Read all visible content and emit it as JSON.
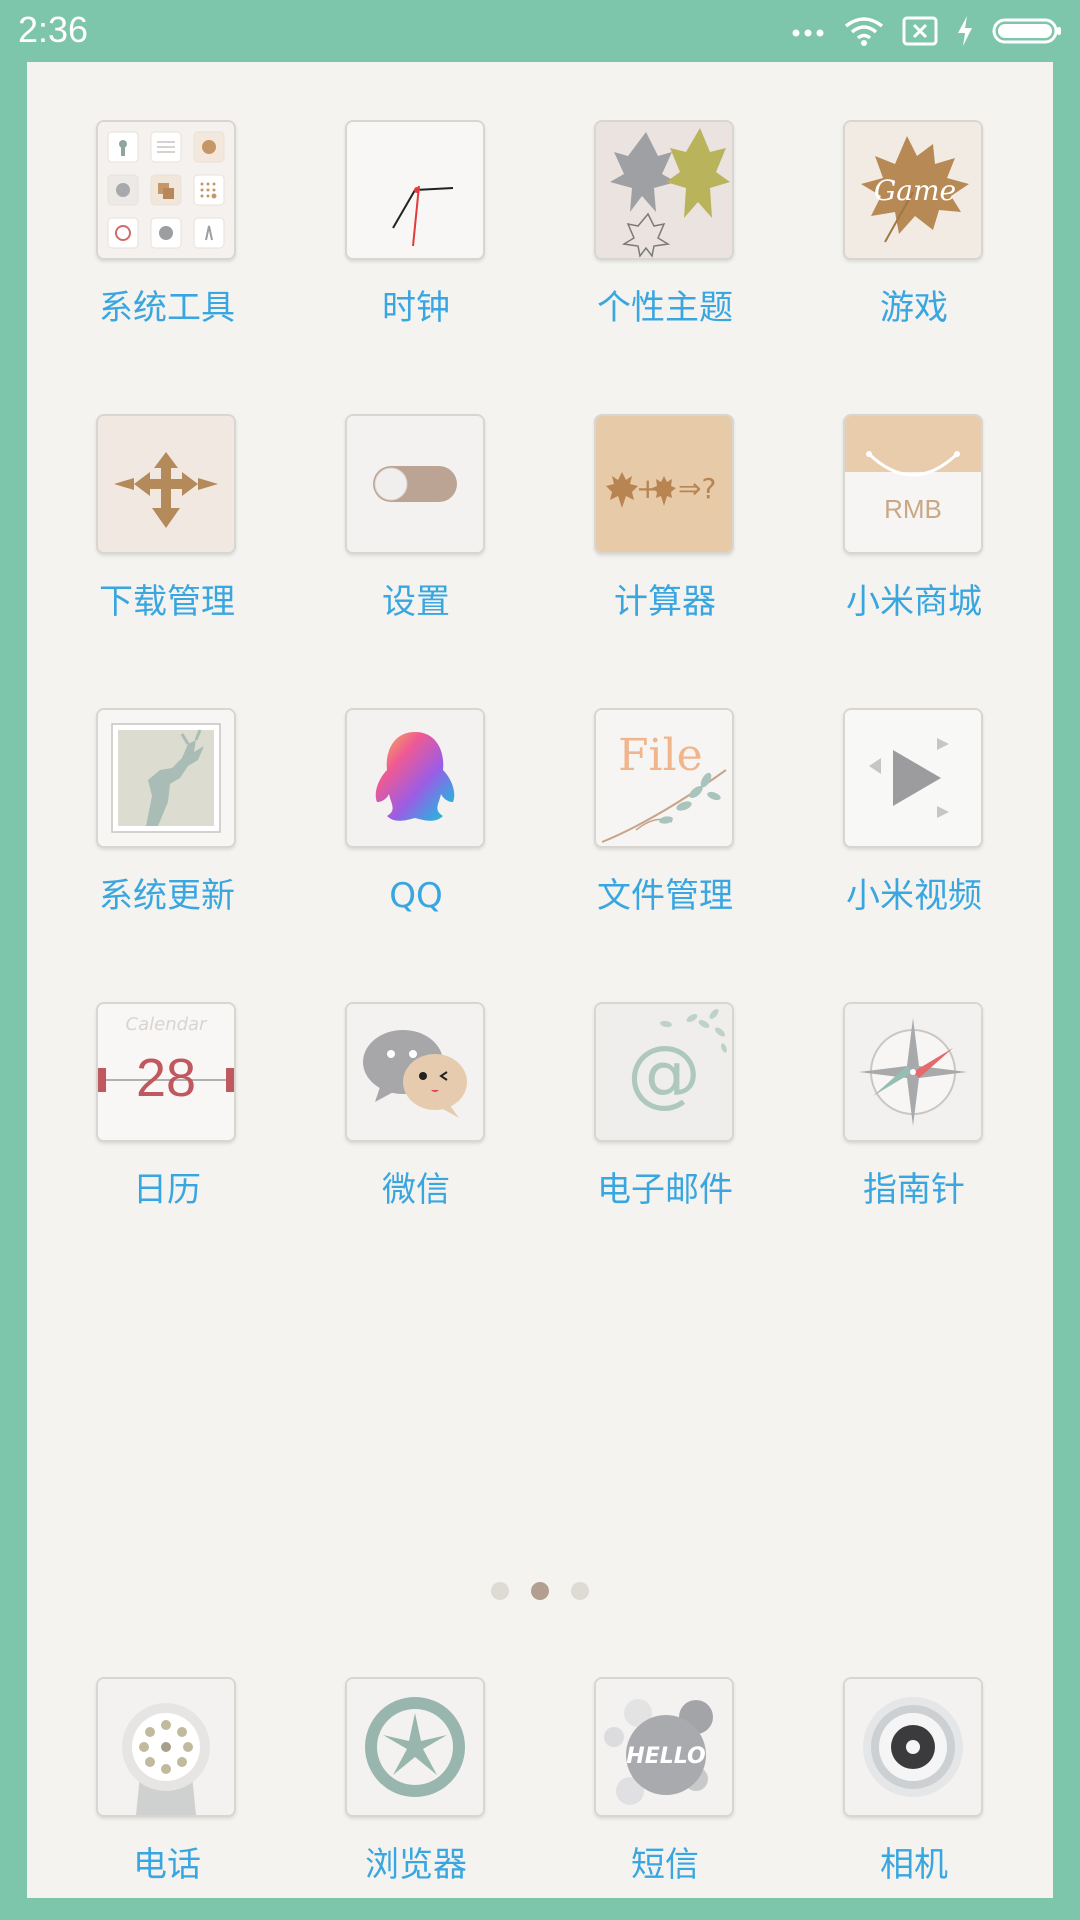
{
  "status_bar": {
    "time": "2:36",
    "icons": [
      "more-dots-icon",
      "wifi-icon",
      "no-sim-icon",
      "charging-icon",
      "battery-icon"
    ]
  },
  "apps": [
    {
      "id": "system-tools",
      "label": "系统工具",
      "icon": "system-tools-icon"
    },
    {
      "id": "clock",
      "label": "时钟",
      "icon": "clock-icon"
    },
    {
      "id": "themes",
      "label": "个性主题",
      "icon": "themes-icon"
    },
    {
      "id": "games",
      "label": "游戏",
      "icon": "game-icon",
      "icon_text": "Game"
    },
    {
      "id": "downloads",
      "label": "下载管理",
      "icon": "downloads-icon"
    },
    {
      "id": "settings",
      "label": "设置",
      "icon": "settings-toggle-icon"
    },
    {
      "id": "calculator",
      "label": "计算器",
      "icon": "calculator-icon",
      "icon_text": "+ ⇒?"
    },
    {
      "id": "mi-store",
      "label": "小米商城",
      "icon": "shopping-bag-icon",
      "icon_text": "RMB"
    },
    {
      "id": "system-update",
      "label": "系统更新",
      "icon": "deer-update-icon"
    },
    {
      "id": "qq",
      "label": "QQ",
      "icon": "qq-penguin-icon"
    },
    {
      "id": "file-manager",
      "label": "文件管理",
      "icon": "file-icon",
      "icon_text": "File"
    },
    {
      "id": "mi-video",
      "label": "小米视频",
      "icon": "play-icon"
    },
    {
      "id": "calendar",
      "label": "日历",
      "icon": "calendar-icon",
      "icon_text": "Calendar",
      "icon_number": "28"
    },
    {
      "id": "wechat",
      "label": "微信",
      "icon": "wechat-icon"
    },
    {
      "id": "email",
      "label": "电子邮件",
      "icon": "email-at-icon",
      "icon_text": "@"
    },
    {
      "id": "compass",
      "label": "指南针",
      "icon": "compass-icon"
    }
  ],
  "pager": {
    "total": 3,
    "active": 2
  },
  "dock": [
    {
      "id": "phone",
      "label": "电话",
      "icon": "phone-dialpad-icon"
    },
    {
      "id": "browser",
      "label": "浏览器",
      "icon": "browser-icon"
    },
    {
      "id": "messages",
      "label": "短信",
      "icon": "messages-hello-icon",
      "icon_text": "HELLO"
    },
    {
      "id": "camera",
      "label": "相机",
      "icon": "camera-lens-icon"
    }
  ]
}
